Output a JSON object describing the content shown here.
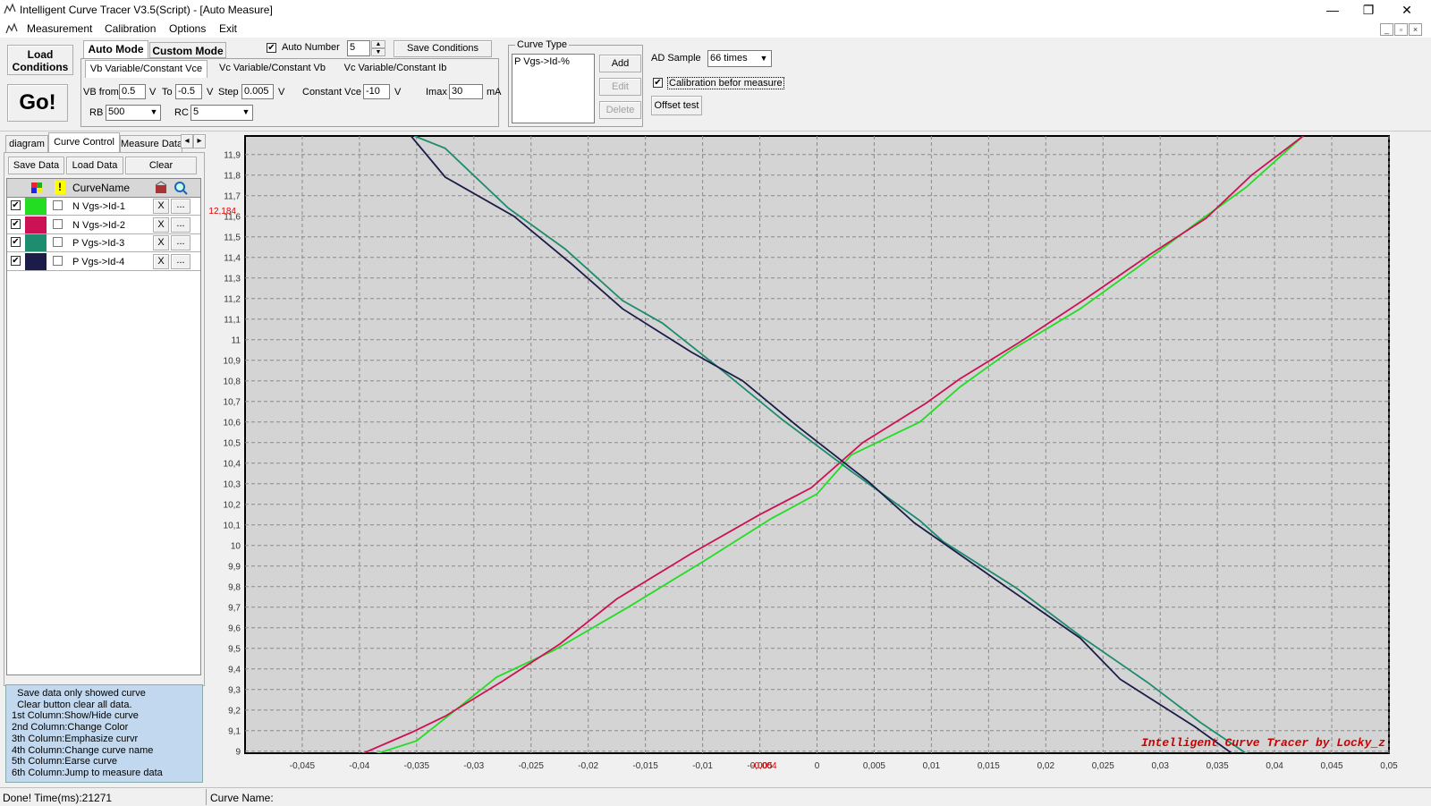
{
  "window": {
    "title": "Intelligent Curve Tracer V3.5(Script) - [Auto Measure]",
    "min": "—",
    "max": "❐",
    "close": "✕"
  },
  "menu": [
    "Measurement",
    "Calibration",
    "Options",
    "Exit"
  ],
  "mdi": {
    "min": "_",
    "restore": "▫",
    "close": "×"
  },
  "toolbar": {
    "load_conditions": "Load Conditions",
    "go": "Go!",
    "auto_mode": "Auto Mode",
    "custom_mode": "Custom Mode",
    "auto_number_label": "Auto Number",
    "auto_number_value": "5",
    "auto_number_checked": "✔",
    "save_conditions": "Save Conditions",
    "mode_tabs": [
      "Vb Variable/Constant Vce",
      "Vc Variable/Constant Vb",
      "Vc Variable/Constant Ib"
    ],
    "vb_from_label": "VB from",
    "vb_from_value": "0.5",
    "v_unit": "V",
    "to_label": "To",
    "to_value": "-0.5",
    "step_label": "Step",
    "step_value": "0.005",
    "constant_vce_label": "Constant Vce",
    "constant_vce_value": "-10",
    "imax_label": "Imax",
    "imax_value": "30",
    "ma_unit": "mA",
    "rb_label": "RB",
    "rb_value": "500",
    "rc_label": "RC",
    "rc_value": "5",
    "curve_type_label": "Curve Type",
    "curve_type_item": "P Vgs->Id-%",
    "add": "Add",
    "edit": "Edit",
    "delete": "Delete",
    "ad_sample_label": "AD Sample",
    "ad_sample_value": "66 times",
    "calibration_label": "Calibration befor measure",
    "calibration_checked": "✔",
    "offset_test": "Offset test"
  },
  "left": {
    "tabs": [
      "diagram",
      "Curve Control",
      "Measure Data"
    ],
    "scroll_left": "◂",
    "scroll_right": "▸",
    "save_data": "Save Data",
    "load_data": "Load Data",
    "clear": "Clear",
    "col_curve_name": "CurveName",
    "col_emph": "!",
    "rows": [
      {
        "name": "N Vgs->Id-1",
        "color": "#22dd22",
        "shown": "✔",
        "x": "X",
        "more": "..."
      },
      {
        "name": "N Vgs->Id-2",
        "color": "#cc1155",
        "shown": "✔",
        "x": "X",
        "more": "..."
      },
      {
        "name": "P Vgs->Id-3",
        "color": "#1e8c6e",
        "shown": "✔",
        "x": "X",
        "more": "..."
      },
      {
        "name": "P Vgs->Id-4",
        "color": "#1c1c4a",
        "shown": "✔",
        "x": "X",
        "more": "..."
      }
    ],
    "help": [
      "  Save data only showed curve",
      "  Clear button clear all data.",
      "1st Column:Show/Hide curve",
      "2nd Column:Change Color",
      "3th Column:Emphasize curvr",
      "4th Column:Change curve name",
      "5th Column:Earse curve",
      "6th Column:Jump to measure data"
    ]
  },
  "status": {
    "left": "Done!  Time(ms):21271",
    "curve_name_label": "Curve Name:"
  },
  "chart_data": {
    "type": "line",
    "xlim": [
      -0.05,
      0.05
    ],
    "ylim": [
      8.99,
      11.99
    ],
    "x_ticks": [
      "-0,045",
      "-0,04",
      "-0,035",
      "-0,03",
      "-0,025",
      "-0,02",
      "-0,015",
      "-0,01",
      "-0,005",
      "0",
      "0,005",
      "0,01",
      "0,015",
      "0,02",
      "0,025",
      "0,03",
      "0,035",
      "0,04",
      "0,045",
      "0,05"
    ],
    "y_ticks": [
      "9",
      "9,1",
      "9,2",
      "9,3",
      "9,4",
      "9,5",
      "9,6",
      "9,7",
      "9,8",
      "9,9",
      "10",
      "10,1",
      "10,2",
      "10,3",
      "10,4",
      "10,5",
      "10,6",
      "10,7",
      "10,8",
      "10,9",
      "11",
      "11,1",
      "11,2",
      "11,3",
      "11,4",
      "11,5",
      "11,6",
      "11,7",
      "11,8",
      "11,9"
    ],
    "cursor_x_label": "-0,004",
    "cursor_y_label": "12,184",
    "watermark": "Intelligent Curve Tracer by Locky_z",
    "grid": true,
    "series": [
      {
        "color": "#22dd22",
        "x": [
          -0.0395,
          -0.035,
          -0.0325,
          -0.028,
          -0.023,
          -0.0165,
          -0.01,
          -0.004,
          0.0,
          0.003,
          0.009,
          0.0125,
          0.017,
          0.023,
          0.028,
          0.033,
          0.0375,
          0.0425
        ],
        "y": [
          8.97,
          9.05,
          9.16,
          9.36,
          9.49,
          9.7,
          9.92,
          10.13,
          10.25,
          10.44,
          10.6,
          10.77,
          10.95,
          11.15,
          11.35,
          11.56,
          11.74,
          11.99
        ]
      },
      {
        "color": "#cc1155",
        "x": [
          -0.0405,
          -0.0355,
          -0.0325,
          -0.0275,
          -0.0225,
          -0.0175,
          -0.011,
          -0.005,
          -0.0005,
          0.004,
          0.0095,
          0.0125,
          0.0175,
          0.0235,
          0.029,
          0.034,
          0.038,
          0.0425
        ],
        "y": [
          8.97,
          9.09,
          9.17,
          9.34,
          9.52,
          9.74,
          9.96,
          10.15,
          10.28,
          10.5,
          10.69,
          10.81,
          10.98,
          11.2,
          11.41,
          11.59,
          11.8,
          11.99
        ]
      },
      {
        "color": "#1e8c6e",
        "x": [
          -0.0352,
          -0.0325,
          -0.027,
          -0.022,
          -0.017,
          -0.0135,
          -0.0085,
          -0.003,
          0.003,
          0.009,
          0.011,
          0.0175,
          0.023,
          0.029,
          0.0335,
          0.0375,
          0.0405
        ],
        "y": [
          11.99,
          11.93,
          11.64,
          11.44,
          11.19,
          11.08,
          10.86,
          10.61,
          10.36,
          10.12,
          10.02,
          9.79,
          9.56,
          9.33,
          9.14,
          8.99,
          8.93
        ]
      },
      {
        "color": "#1c1c4a",
        "x": [
          -0.0355,
          -0.0325,
          -0.0265,
          -0.0215,
          -0.017,
          -0.011,
          -0.0065,
          -0.0015,
          0.0045,
          0.0085,
          0.0165,
          0.023,
          0.0265,
          0.033,
          0.038,
          0.041
        ],
        "y": [
          11.99,
          11.79,
          11.6,
          11.37,
          11.15,
          10.94,
          10.8,
          10.57,
          10.31,
          10.11,
          9.8,
          9.55,
          9.35,
          9.12,
          8.92,
          8.88
        ]
      }
    ]
  }
}
